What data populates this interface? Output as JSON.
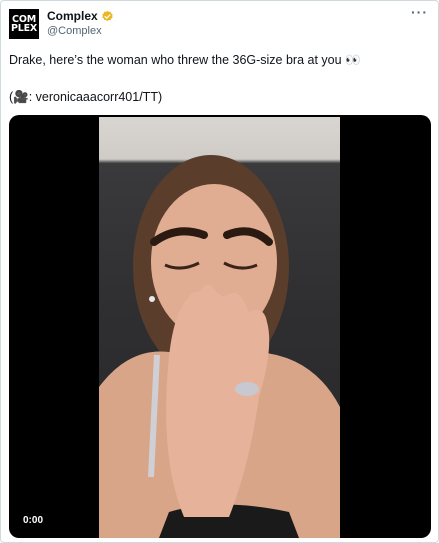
{
  "account": {
    "avatar_text_line1": "COM",
    "avatar_text_line2": "PLEX",
    "display_name": "Complex",
    "handle": "@Complex",
    "verified_color": "#E8B829"
  },
  "tweet": {
    "text_line1": "Drake, here’s the woman who threw the 36G-size bra at you 👀",
    "text_line2": "(🎥: veronicaaacorr401/TT)"
  },
  "media": {
    "timestamp": "0:00"
  },
  "menu": {
    "more_label": "···"
  }
}
